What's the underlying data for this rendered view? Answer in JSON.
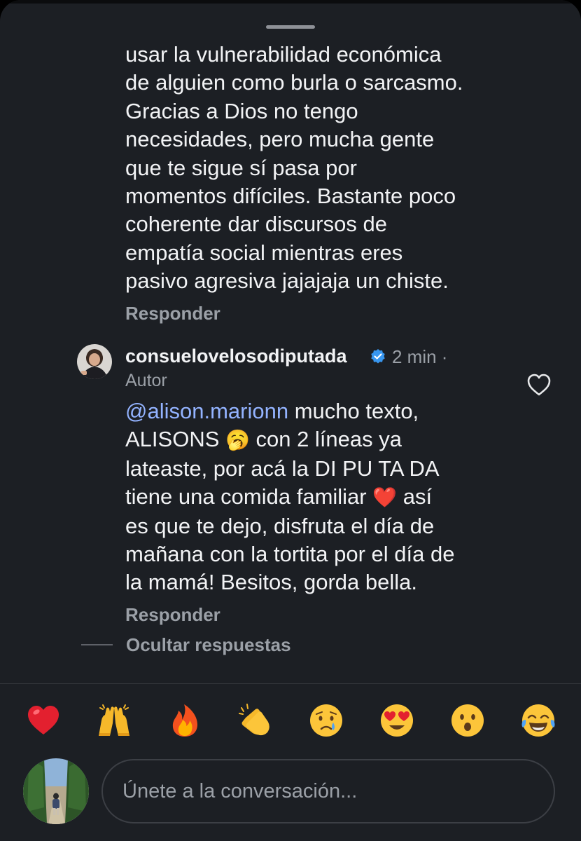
{
  "colors": {
    "background": "#1c1f24",
    "text": "#f2f3f5",
    "secondary_text": "#9ba0a7",
    "mention": "#93b3ff",
    "verified": "#3897f0"
  },
  "previous_comment": {
    "text": "usar la vulnerabilidad económica\nde alguien como burla o sarcasmo.\nGracias a Dios no tengo\nnecesidades, pero mucha gente\nque te sigue sí pasa por\nmomentos difíciles. Bastante poco\ncoherente dar discursos de\nempatía social mientras eres\npasivo agresiva jajajaja un chiste.",
    "reply_label": "Responder"
  },
  "reply": {
    "username": "consuelovelosodiputada",
    "verified_icon": "verified-badge-icon",
    "time": "2 min ·",
    "author_label": "Autor",
    "mention": "@alison.marionn",
    "text_1": " mucho texto,\nALISONS ",
    "emoji_1": "🥱",
    "text_2": " con 2 líneas ya\nlateaste, por acá la DI PU TA DA\ntiene una comida familiar ",
    "emoji_2": "❤️",
    "text_3": " así\nes que te dejo, disfruta el día de\nmañana con la tortita por el día de\nla mamá! Besitos, gorda bella.",
    "reply_label": "Responder",
    "like_icon": "heart-outline-icon"
  },
  "hide_replies_label": "Ocultar respuestas",
  "reactions": [
    {
      "name": "red-heart",
      "emoji": "❤️"
    },
    {
      "name": "raising-hands",
      "emoji": "🙌"
    },
    {
      "name": "fire",
      "emoji": "🔥"
    },
    {
      "name": "clapping-hands",
      "emoji": "👏"
    },
    {
      "name": "crying-face",
      "emoji": "😢"
    },
    {
      "name": "heart-eyes",
      "emoji": "😍"
    },
    {
      "name": "surprised-face",
      "emoji": "😮"
    },
    {
      "name": "tears-of-joy",
      "emoji": "😂"
    }
  ],
  "composer": {
    "placeholder": "Únete a la conversación..."
  }
}
